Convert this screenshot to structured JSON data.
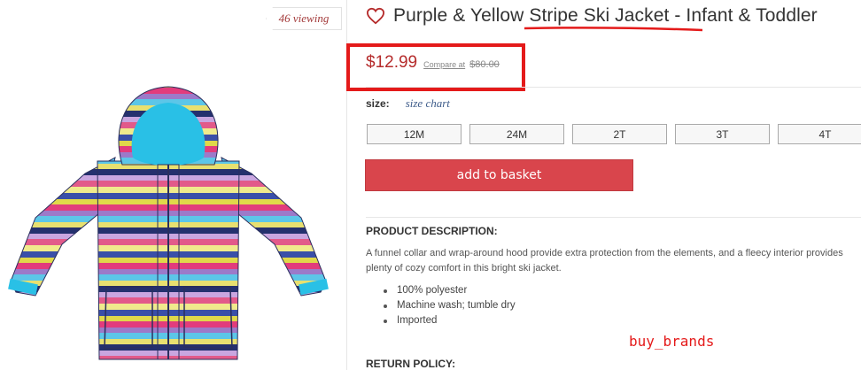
{
  "image_panel": {
    "viewing_badge": "46 viewing",
    "product_image_icon": "striped-ski-jacket-image"
  },
  "product": {
    "favorite_icon": "heart-outline-icon",
    "title": "Purple & Yellow Stripe Ski Jacket - Infant & Toddler",
    "price": "$12.99",
    "compare_label": "Compare at",
    "compare_price": "$80.00"
  },
  "size": {
    "label": "size:",
    "chart_link": "size chart",
    "options": [
      "12M",
      "24M",
      "2T",
      "3T",
      "4T"
    ]
  },
  "add_to_basket_label": "add to basket",
  "description": {
    "heading": "PRODUCT DESCRIPTION:",
    "body": "A funnel collar and wrap-around hood provide extra protection from the elements, and a fleecy interior provides plenty of cozy comfort in this bright ski jacket.",
    "bullets": [
      "100% polyester",
      "Machine wash; tumble dry",
      "Imported"
    ]
  },
  "watermark": "buy_brands",
  "return_policy_heading": "RETURN POLICY:",
  "colors": {
    "annotation_red": "#e41a1a",
    "price_red": "#b52b2b",
    "button_red": "#d9454c",
    "link_blue": "#3e5c8a"
  }
}
